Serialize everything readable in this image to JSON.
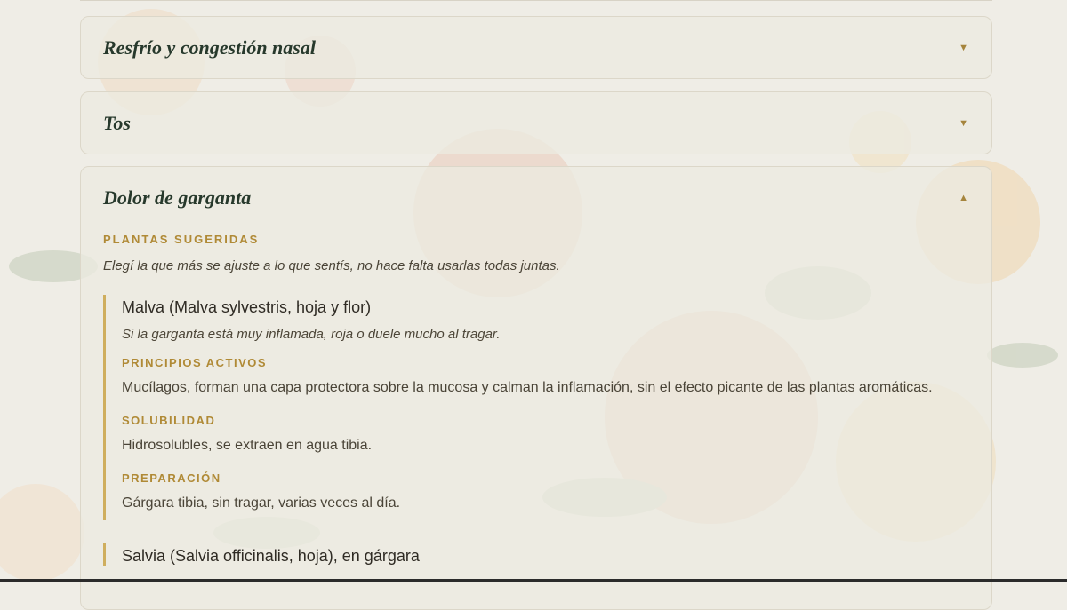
{
  "accordion": [
    {
      "title": "Resfrío y congestión nasal",
      "chevron": "▼",
      "expanded": false
    },
    {
      "title": "Tos",
      "chevron": "▼",
      "expanded": false
    },
    {
      "title": "Dolor de garganta",
      "chevron": "▲",
      "expanded": true
    }
  ],
  "sore_throat": {
    "section_label": "PLANTAS SUGERIDAS",
    "intro": "Elegí la que más se ajuste a lo que sentís, no hace falta usarlas todas juntas.",
    "plants": [
      {
        "name": "Malva (Malva sylvestris, hoja y flor)",
        "when": "Si la garganta está muy inflamada, roja o duele mucho al tragar.",
        "active_label": "PRINCIPIOS ACTIVOS",
        "active_text": "Mucílagos, forman una capa protectora sobre la mucosa y calman la inflamación, sin el efecto picante de las plantas aromáticas.",
        "solubility_label": "SOLUBILIDAD",
        "solubility_text": "Hidrosolubles, se extraen en agua tibia.",
        "preparation_label": "PREPARACIÓN",
        "preparation_text": "Gárgara tibia, sin tragar, varias veces al día."
      },
      {
        "name": "Salvia (Salvia officinalis, hoja), en gárgara"
      }
    ]
  },
  "colors": {
    "heading": "#27392c",
    "accent_gold": "#b08a36",
    "border_gold": "#cfae5e",
    "text": "#4a4437"
  },
  "icons": {
    "collapsed": "chevron-down-icon",
    "expanded": "chevron-up-icon"
  }
}
